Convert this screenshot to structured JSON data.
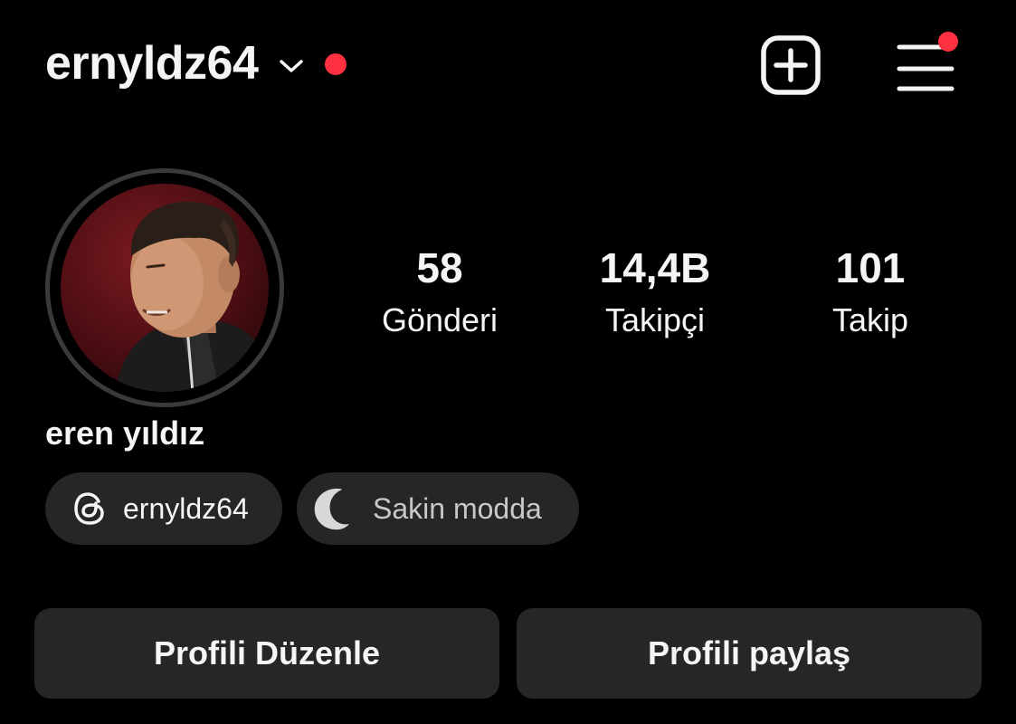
{
  "header": {
    "username": "ernyldz64",
    "icons": {
      "chevron": "chevron-down-icon",
      "notification_dot": "red-dot",
      "add": "plus-square-icon",
      "menu": "hamburger-menu-icon"
    },
    "accent_color": "#ff3040"
  },
  "profile": {
    "avatar": "profile-photo",
    "display_name": "eren yıldız",
    "stats": {
      "posts": {
        "value": "58",
        "label": "Gönderi"
      },
      "followers": {
        "value": "14,4B",
        "label": "Takipçi"
      },
      "following": {
        "value": "101",
        "label": "Takip"
      }
    }
  },
  "chips": {
    "threads": {
      "icon": "threads-icon",
      "label": "ernyldz64"
    },
    "quiet_mode": {
      "icon": "moon-icon",
      "label": "Sakin modda"
    }
  },
  "actions": {
    "edit_profile": "Profili Düzenle",
    "share_profile": "Profili paylaş"
  },
  "colors": {
    "background": "#000000",
    "surface": "#262626",
    "text": "#f5f5f5"
  }
}
